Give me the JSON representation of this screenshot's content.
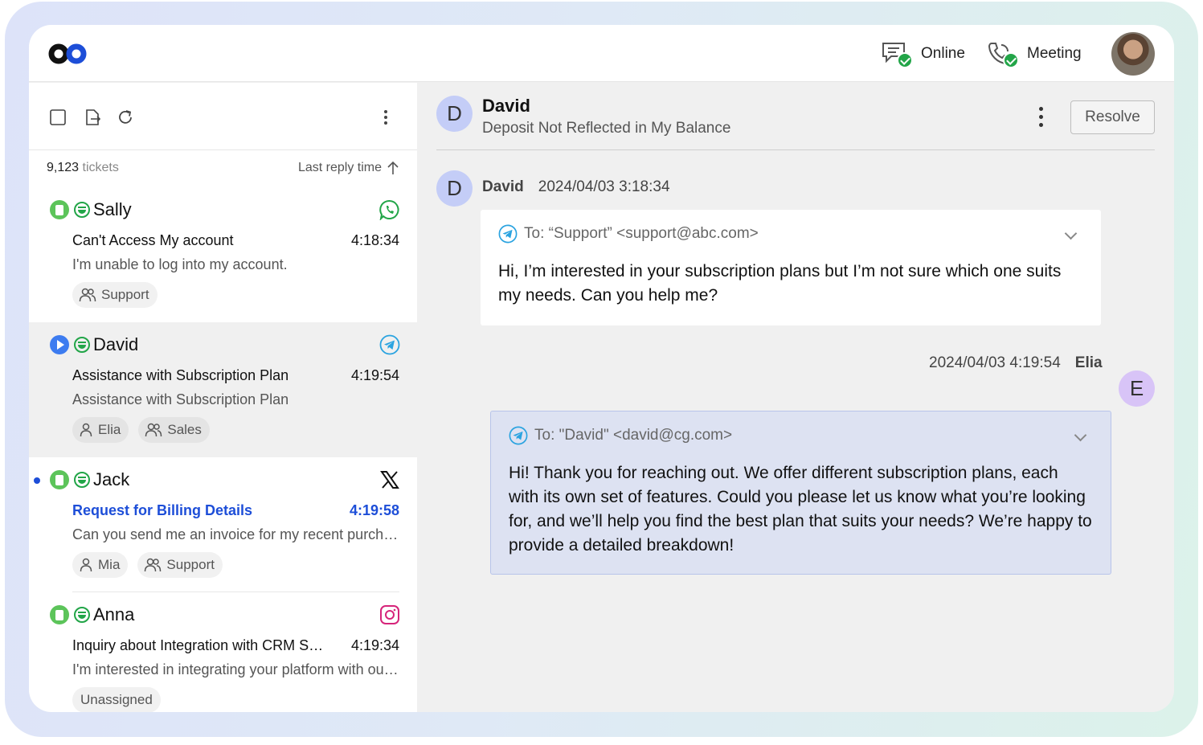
{
  "header": {
    "status": [
      {
        "label": "Online",
        "icon": "chat-status-icon"
      },
      {
        "label": "Meeting",
        "icon": "phone-status-icon"
      }
    ]
  },
  "list": {
    "count": "9,123",
    "count_suffix": "tickets",
    "sort_label": "Last reply time",
    "tickets": [
      {
        "name": "Sally",
        "channel": "whatsapp",
        "subject": "Can't Access My account",
        "time": "4:18:34",
        "preview": "I'm unable to log into my account.",
        "tags": [
          "Support"
        ],
        "status": "open",
        "unread": false
      },
      {
        "name": "David",
        "channel": "telegram",
        "subject": "Assistance with Subscription Plan",
        "time": "4:19:54",
        "preview": "Assistance with Subscription Plan",
        "tags": [
          "Elia",
          "Sales"
        ],
        "status": "replied",
        "unread": false,
        "selected": true
      },
      {
        "name": "Jack",
        "channel": "x",
        "subject": "Request for Billing Details",
        "time": "4:19:58",
        "preview": "Can you send me an invoice for my recent purchase?",
        "tags": [
          "Mia",
          "Support"
        ],
        "status": "open",
        "unread": true
      },
      {
        "name": "Anna",
        "channel": "instagram",
        "subject": "Inquiry about Integration with CRM Systems",
        "time": "4:19:34",
        "preview": "I'm interested in integrating your platform with our CRM system.",
        "tags": [
          "Unassigned"
        ],
        "status": "open",
        "unread": false
      }
    ]
  },
  "conversation": {
    "avatar_letter": "D",
    "name": "David",
    "subject": "Deposit Not Reflected in My Balance",
    "resolve_label": "Resolve",
    "messages": [
      {
        "sender": "David",
        "avatar_letter": "D",
        "timestamp": "2024/04/03 3:18:34",
        "to": "To: “Support” <support@abc.com>",
        "body_lines": [
          "Hi, I’m interested in your subscription plans but I’m not sure which one suits",
          "my needs. Can you help me?"
        ]
      },
      {
        "sender": "Elia",
        "avatar_letter": "E",
        "timestamp": "2024/04/03 4:19:54",
        "to": "To: \"David\" <david@cg.com>",
        "body_lines": [
          "Hi! Thank you for reaching out. We offer different subscription plans, each",
          "with its own set of features. Could you please let us know what you’re looking",
          "for, and we’ll help you find the best plan that suits your needs? We’re happy to",
          "provide a detailed breakdown!"
        ]
      }
    ]
  },
  "colors": {
    "accent_blue": "#1d4ed8",
    "status_green": "#22a548",
    "outgoing_bubble": "#dde2f2",
    "avatar_d": "#c4cdf7",
    "avatar_e": "#d8c4f7"
  }
}
